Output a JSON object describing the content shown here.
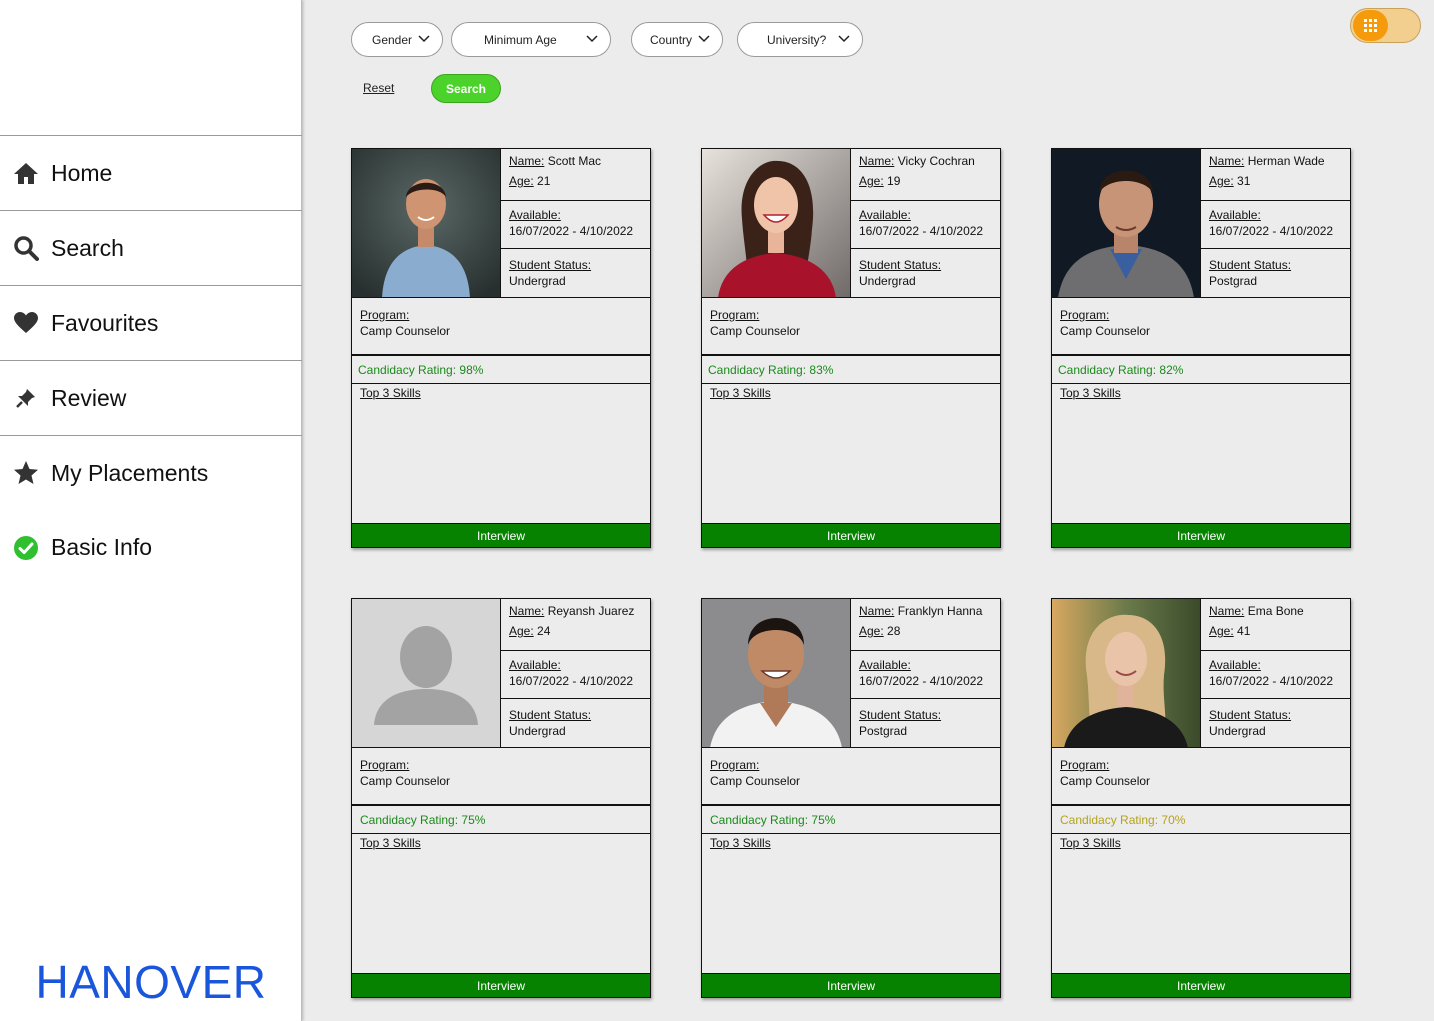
{
  "sidebar": {
    "items": [
      {
        "label": "Home",
        "icon": "home-icon"
      },
      {
        "label": "Search",
        "icon": "search-icon"
      },
      {
        "label": "Favourites",
        "icon": "heart-icon"
      },
      {
        "label": "Review",
        "icon": "pin-icon"
      },
      {
        "label": "My Placements",
        "icon": "star-icon"
      },
      {
        "label": "Basic Info",
        "icon": "check-circle-icon"
      }
    ],
    "brand": "HANOVER"
  },
  "filters": {
    "gender": "Gender",
    "min_age": "Minimum Age",
    "country": "Country",
    "university": "University?",
    "reset": "Reset",
    "search": "Search"
  },
  "colors": {
    "brand": "#1a56db",
    "interview_button": "#068200",
    "rating_high": "#1a8a1a",
    "rating_medium": "#b5a21a",
    "search_button": "#4cd32b",
    "toggle": "#f59a0a"
  },
  "labels": {
    "name": "Name:",
    "age": "Age:",
    "available": "Available:",
    "student_status": "Student Status:",
    "program": "Program:",
    "top_skills": "Top 3 Skills",
    "interview": "Interview"
  },
  "candidates": [
    {
      "name": "Scott Mac",
      "age": "21",
      "available": "16/07/2022 - 4/10/2022",
      "status": "Undergrad",
      "program": "Camp Counselor",
      "rating": "Candidacy Rating: 98%",
      "rating_level": "high"
    },
    {
      "name": "Vicky Cochran",
      "age": "19",
      "available": "16/07/2022 - 4/10/2022",
      "status": "Undergrad",
      "program": "Camp Counselor",
      "rating": "Candidacy Rating: 83%",
      "rating_level": "high"
    },
    {
      "name": "Herman Wade",
      "age": "31",
      "available": "16/07/2022 - 4/10/2022",
      "status": "Postgrad",
      "program": "Camp Counselor",
      "rating": "Candidacy Rating: 82%",
      "rating_level": "high"
    },
    {
      "name": "Reyansh Juarez",
      "age": "24",
      "available": "16/07/2022 - 4/10/2022",
      "status": "Undergrad",
      "program": "Camp Counselor",
      "rating": "Candidacy Rating: 75%",
      "rating_level": "high"
    },
    {
      "name": "Franklyn Hanna",
      "age": "28",
      "available": "16/07/2022 - 4/10/2022",
      "status": "Postgrad",
      "program": "Camp Counselor",
      "rating": "Candidacy Rating: 75%",
      "rating_level": "high"
    },
    {
      "name": "Ema Bone",
      "age": "41",
      "available": "16/07/2022 - 4/10/2022",
      "status": "Undergrad",
      "program": "Camp Counselor",
      "rating": "Candidacy Rating: 70%",
      "rating_level": "medium"
    }
  ]
}
